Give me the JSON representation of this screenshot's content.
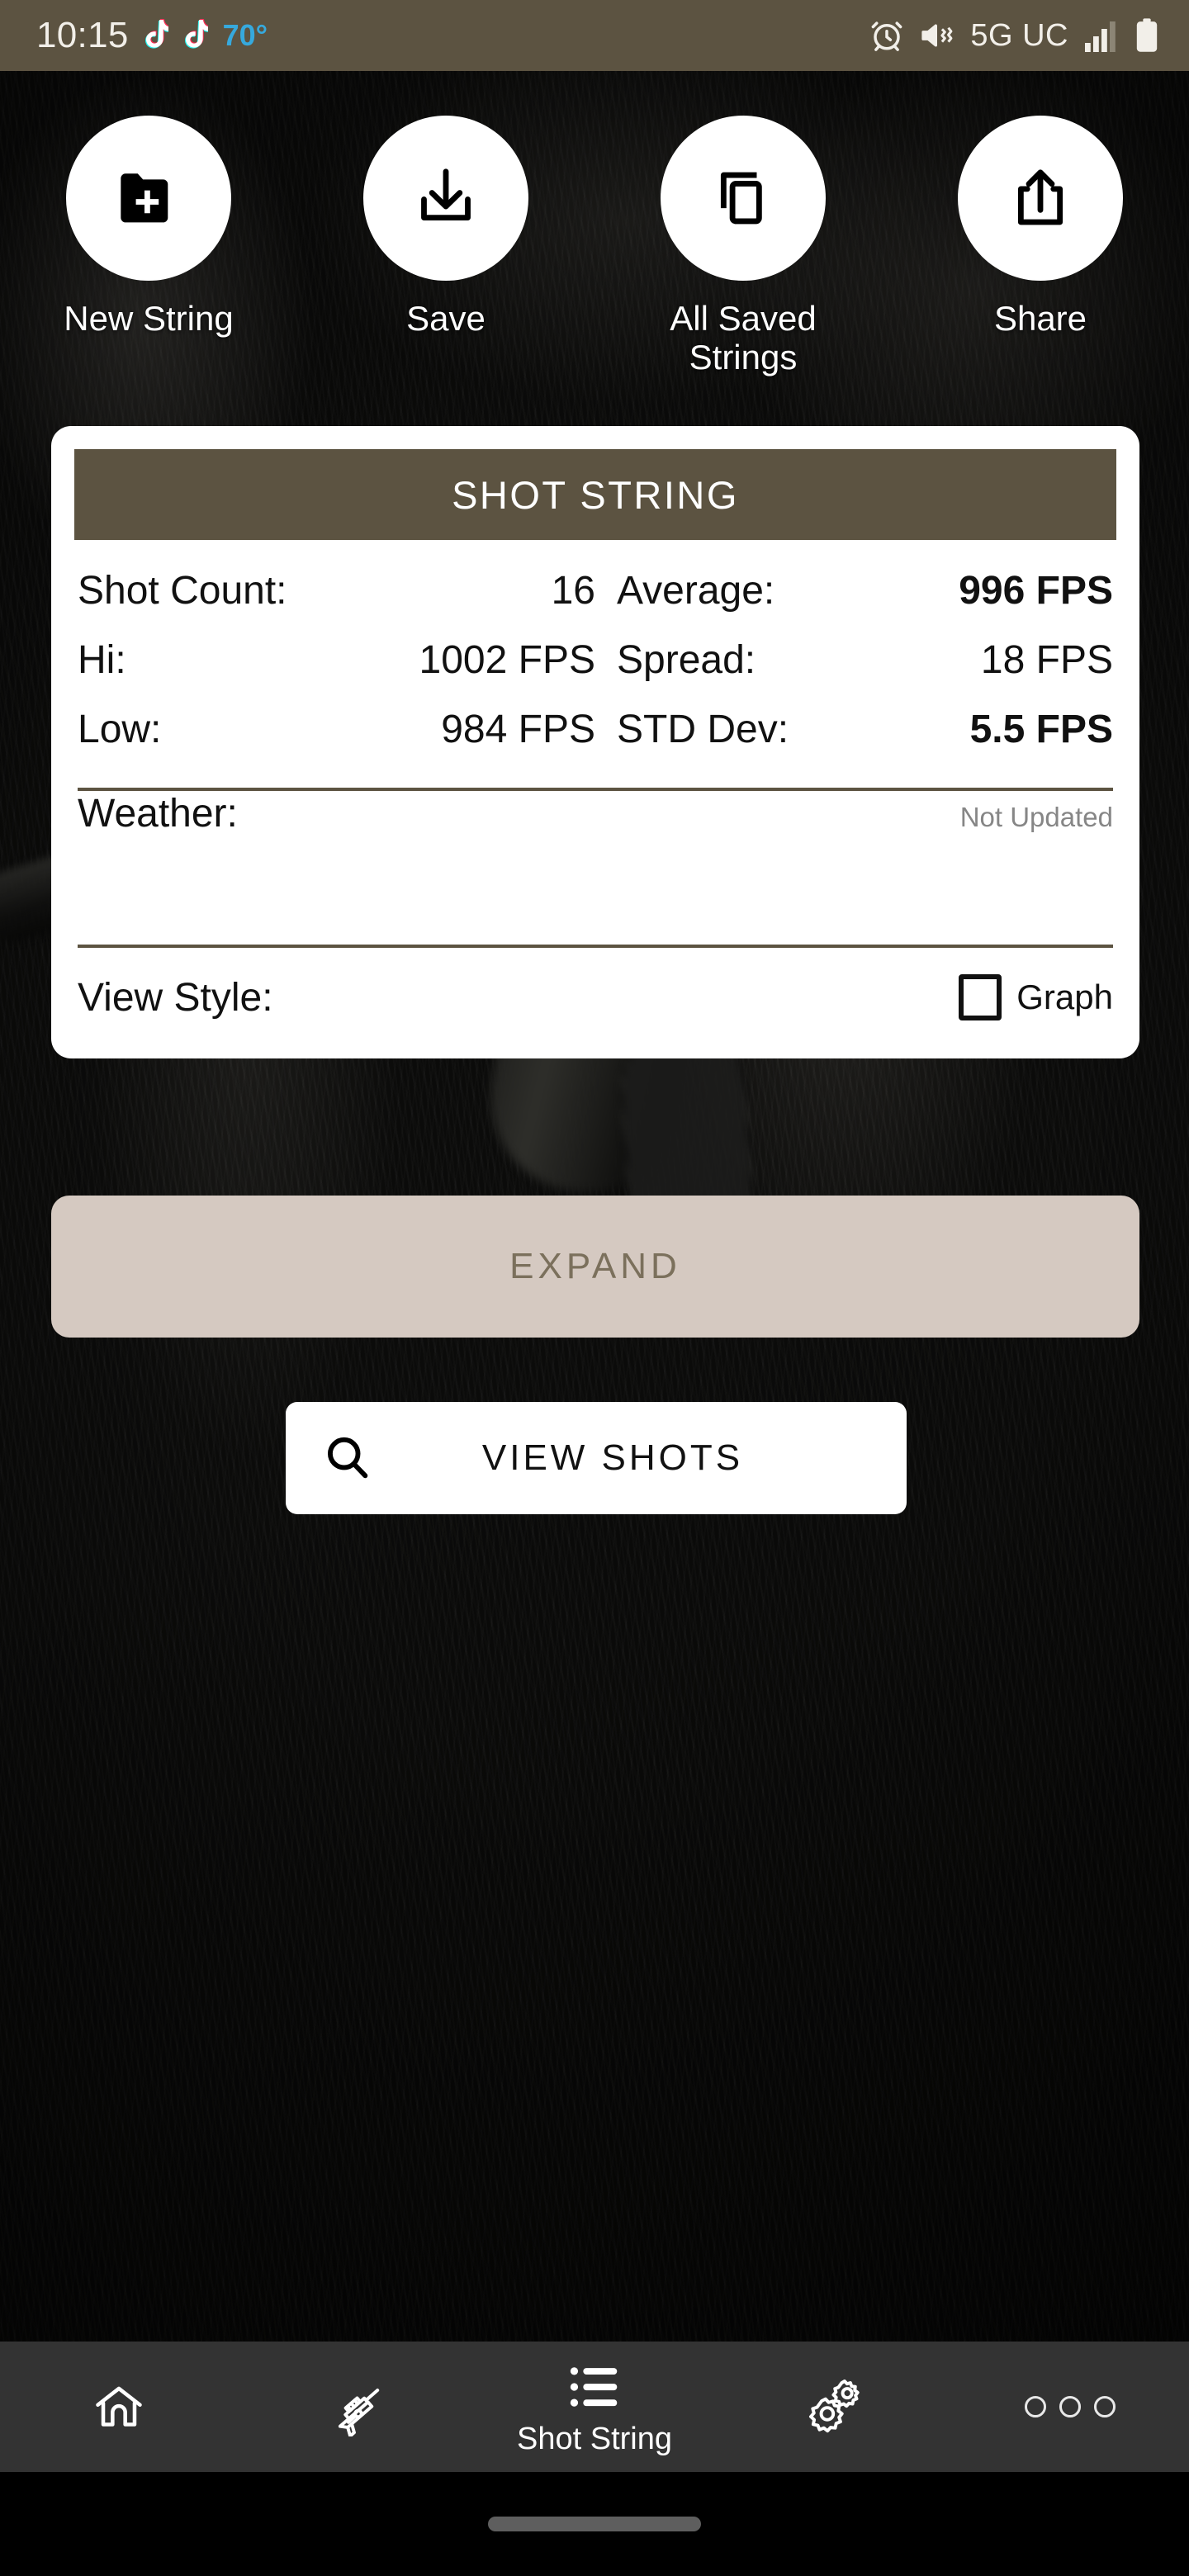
{
  "status_bar": {
    "time": "10:15",
    "temperature": "70°",
    "network": "5G UC",
    "icons": [
      "tiktok-icon",
      "tiktok-icon",
      "alarm-icon",
      "vibrate-icon",
      "signal-icon",
      "battery-icon"
    ],
    "background_color": "#5c5341"
  },
  "actions": [
    {
      "label": "New String",
      "icon": "folder-plus-icon"
    },
    {
      "label": "Save",
      "icon": "download-tray-icon"
    },
    {
      "label": "All Saved Strings",
      "icon": "copy-duplicate-icon"
    },
    {
      "label": "Share",
      "icon": "share-upload-icon"
    }
  ],
  "card": {
    "banner_title": "SHOT STRING",
    "banner_color": "#5c5341",
    "stats": [
      {
        "key": "Shot Count:",
        "value": "16",
        "bold": false
      },
      {
        "key": "Average:",
        "value": "996 FPS",
        "bold": true
      },
      {
        "key": "Hi:",
        "value": "1002 FPS",
        "bold": false
      },
      {
        "key": "Spread:",
        "value": "18 FPS",
        "bold": false
      },
      {
        "key": "Low:",
        "value": "984 FPS",
        "bold": false
      },
      {
        "key": "STD Dev:",
        "value": "5.5 FPS",
        "bold": true
      }
    ],
    "weather": {
      "label": "Weather:",
      "value": "Not Updated"
    },
    "view_style": {
      "label": "View Style:",
      "checkbox_label": "Graph",
      "checked": false
    }
  },
  "expand_button": {
    "label": "EXPAND",
    "background_color": "#d5c9c1",
    "text_color": "#7b705c"
  },
  "view_shots_button": {
    "label": "VIEW SHOTS",
    "icon": "search-icon"
  },
  "bottom_nav": {
    "background_color": "#333333",
    "items": [
      {
        "label": "",
        "icon": "home-icon",
        "active": false
      },
      {
        "label": "",
        "icon": "rifle-icon",
        "active": false
      },
      {
        "label": "Shot String",
        "icon": "list-icon",
        "active": true
      },
      {
        "label": "",
        "icon": "gears-icon",
        "active": false
      },
      {
        "label": "",
        "icon": "more-dots-icon",
        "active": false
      }
    ]
  }
}
